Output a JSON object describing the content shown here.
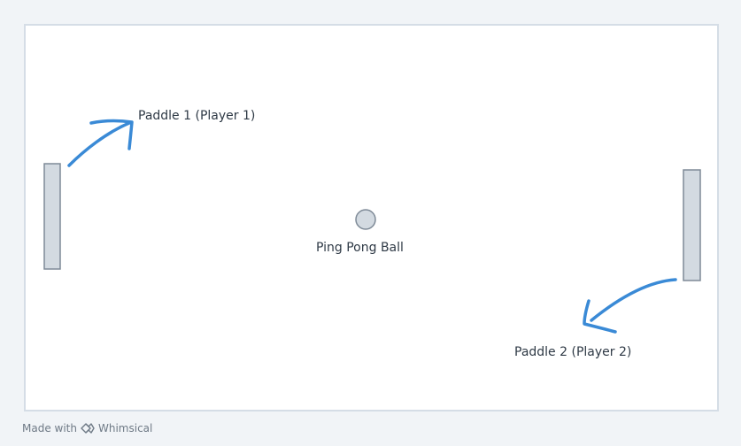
{
  "diagram": {
    "labels": {
      "paddle1": "Paddle 1 (Player 1)",
      "ball": "Ping Pong Ball",
      "paddle2": "Paddle 2 (Player 2)"
    },
    "colors": {
      "canvas_bg": "#f1f4f7",
      "board_bg": "#ffffff",
      "board_border": "#d5dde6",
      "shape_fill": "#d3dae1",
      "shape_stroke": "#7e8a97",
      "arrow": "#3a8ad6",
      "text": "#2f3a46"
    },
    "icons": {
      "arrow_paddle1": "curved-arrow-up-right-icon",
      "arrow_paddle2": "curved-arrow-down-left-icon"
    }
  },
  "footer": {
    "made_with": "Made with",
    "brand": "Whimsical",
    "brand_icon": "whimsical-logo-icon"
  }
}
